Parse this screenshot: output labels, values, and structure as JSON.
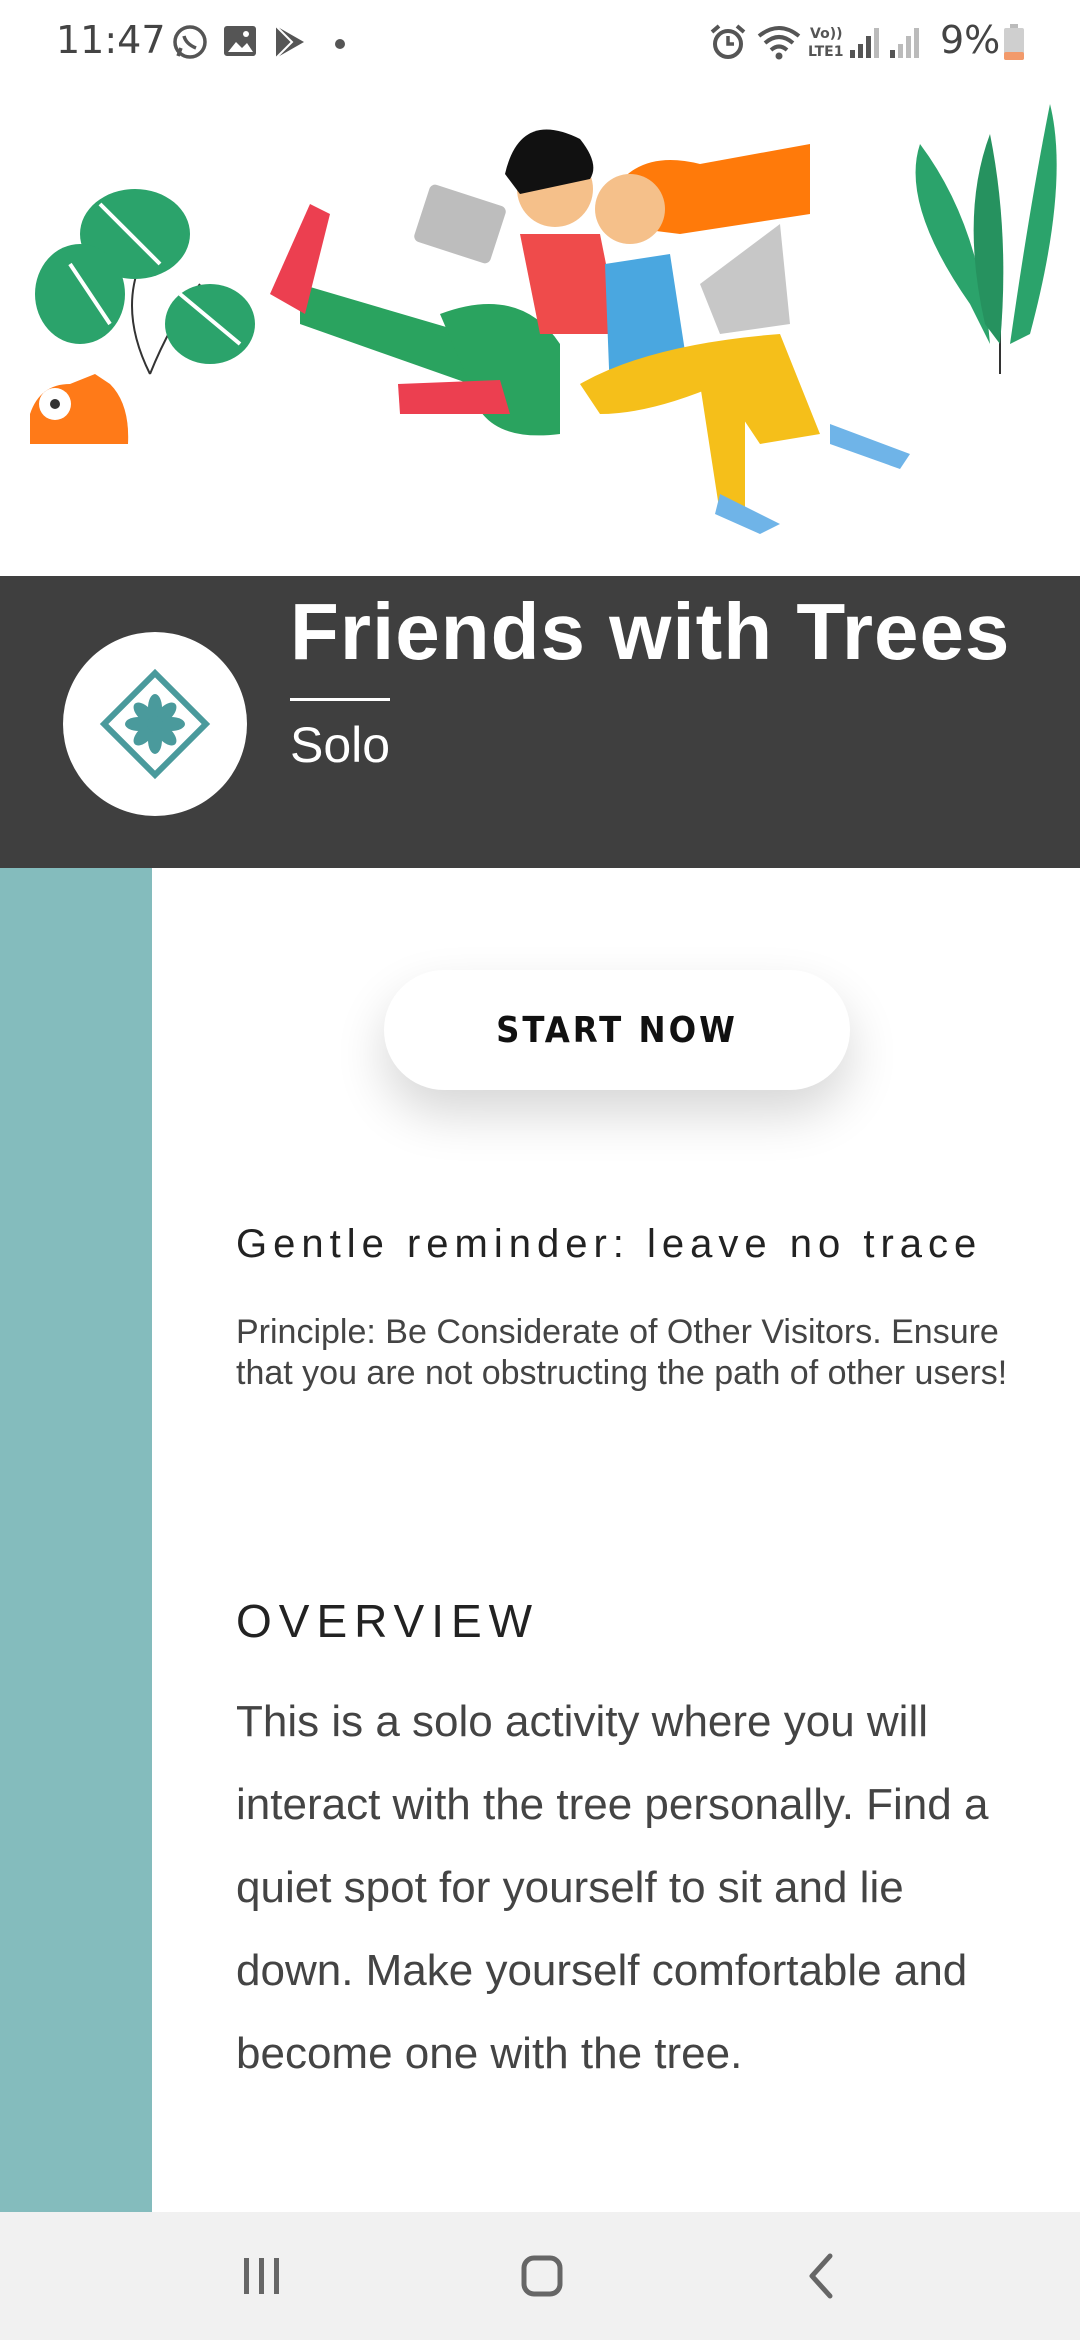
{
  "status_bar": {
    "time": "11:47",
    "battery": "9%",
    "icons": [
      "whatsapp-icon",
      "gallery-icon",
      "play-store-icon",
      "dot-icon",
      "alarm-icon",
      "wifi-icon",
      "volte-icon",
      "signal-icon",
      "signal-icon",
      "battery-icon"
    ],
    "volte_label": "Vo)) LTE1"
  },
  "header": {
    "title": "Friends with Trees",
    "subtitle": "Solo"
  },
  "actions": {
    "start_label": "START NOW"
  },
  "reminder": {
    "title": "Gentle reminder: leave no trace",
    "body": "Principle: Be Considerate of Other Visitors. Ensure that you are not obstructing the path of other users!"
  },
  "overview": {
    "title": "OVERVIEW",
    "body": "This is a solo activity where you will interact with the tree personally. Find a quiet spot for yourself to sit and lie down. Make yourself comfortable and become one with the tree."
  },
  "colors": {
    "band": "#3f3f3f",
    "accent": "#84bcbd",
    "logo": "#4a9a9c"
  },
  "nav": {
    "icons": [
      "recent-apps-icon",
      "home-icon",
      "back-icon"
    ]
  }
}
